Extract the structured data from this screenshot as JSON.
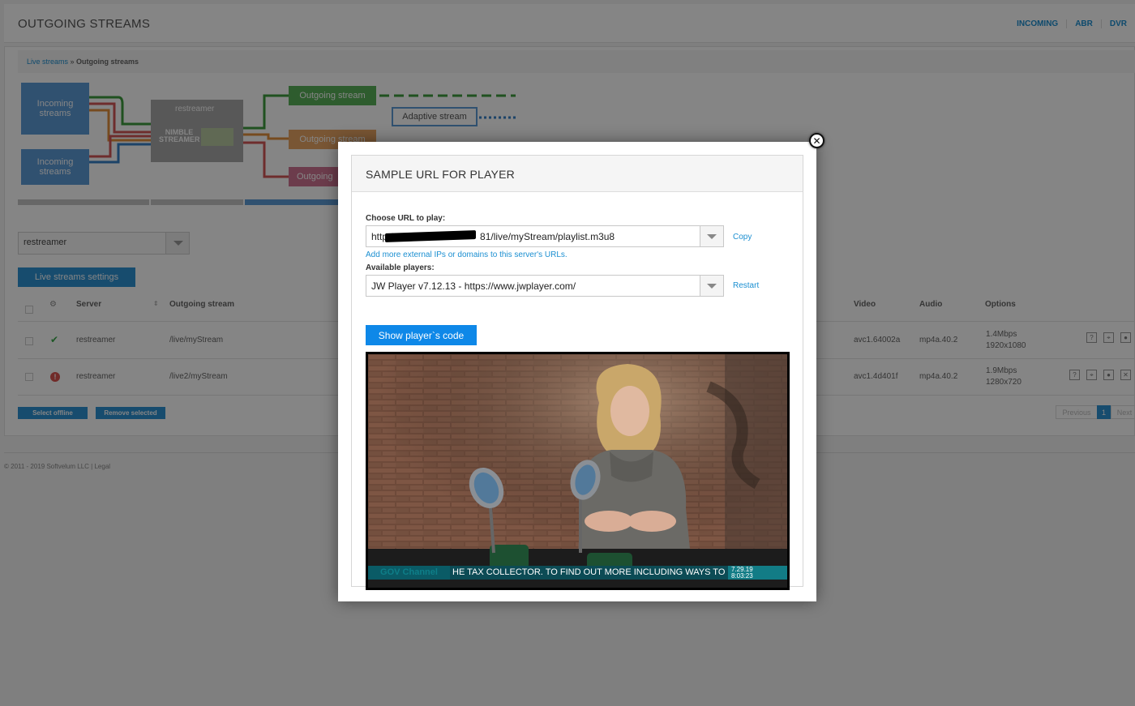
{
  "page": {
    "title": "OUTGOING STREAMS",
    "nav": [
      "INCOMING",
      "ABR",
      "DVR"
    ]
  },
  "breadcrumb": {
    "link": "Live streams",
    "separator": " » ",
    "current": "Outgoing streams"
  },
  "diagram": {
    "incoming_1": "Incoming streams",
    "incoming_2": "Incoming streams",
    "restreamer": "restreamer",
    "nimble": "NIMBLE STREAMER",
    "outgoing_1": "Outgoing stream",
    "outgoing_2": "Outgoing stream",
    "outgoing_3": "Outgoing",
    "adaptive": "Adaptive stream"
  },
  "server_select": {
    "value": "restreamer"
  },
  "live_streams_settings_label": "Live streams settings",
  "table": {
    "headers": {
      "server": "Server",
      "outgoing_stream": "Outgoing stream",
      "video": "Video",
      "audio": "Audio",
      "options": "Options"
    },
    "rows": [
      {
        "server": "restreamer",
        "stream": "/live/myStream",
        "video": "avc1.64002a",
        "audio": "mp4a.40.2",
        "bitrate": "1.4Mbps",
        "resolution": "1920x1080",
        "status": "online"
      },
      {
        "server": "restreamer",
        "stream": "/live2/myStream",
        "video": "avc1.4d401f",
        "audio": "mp4a.40.2",
        "bitrate": "1.9Mbps",
        "resolution": "1280x720",
        "status": "error"
      }
    ]
  },
  "select_offline_label": "Select offline",
  "remove_selected_label": "Remove selected",
  "pager": {
    "previous": "Previous",
    "page": "1",
    "next": "Next"
  },
  "footer": {
    "copyright": "© 2011 - 2019",
    "company": "Softvelum LLC",
    "sep": " | ",
    "legal": "Legal"
  },
  "modal": {
    "title": "SAMPLE URL FOR PLAYER",
    "choose_url_label": "Choose URL to play:",
    "url_prefix": "http://",
    "url_suffix": "81/live/myStream/playlist.m3u8",
    "copy_label": "Copy",
    "add_ips_link": "Add more external IPs or domains to this server's URLs.",
    "available_players_label": "Available players:",
    "player_value": "JW Player v7.12.13 - https://www.jwplayer.com/",
    "restart_label": "Restart",
    "show_code_label": "Show player`s code",
    "video": {
      "channel": "GOV Channel",
      "ticker": "HE TAX COLLECTOR. TO FIND OUT MORE INCLUDING WAYS TO I",
      "date": "7.29.19",
      "time": "8:03:23"
    },
    "close_icon": "close-icon"
  }
}
